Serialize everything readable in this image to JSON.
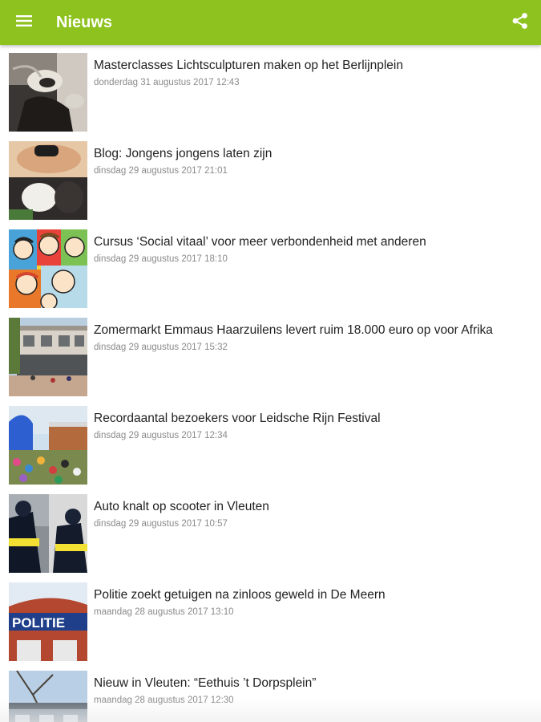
{
  "appbar": {
    "title": "Nieuws",
    "menu_icon": "hamburger-menu-icon",
    "share_icon": "share-icon",
    "color": "#8dc21f"
  },
  "news": [
    {
      "title": "Masterclasses Lichtsculpturen maken op het Berlijnplein",
      "date": "donderdag 31 augustus 2017 12:43"
    },
    {
      "title": "Blog: Jongens jongens laten zijn",
      "date": "dinsdag 29 augustus 2017 21:01"
    },
    {
      "title": "Cursus ‘Social vitaal’ voor meer verbondenheid met anderen",
      "date": "dinsdag 29 augustus 2017 18:10"
    },
    {
      "title": "Zomermarkt Emmaus Haarzuilens levert ruim 18.000 euro op voor Afrika",
      "date": "dinsdag 29 augustus 2017 15:32"
    },
    {
      "title": "Recordaantal bezoekers voor Leidsche Rijn Festival",
      "date": "dinsdag 29 augustus 2017 12:34"
    },
    {
      "title": "Auto knalt op scooter in Vleuten",
      "date": "dinsdag 29 augustus 2017 10:57"
    },
    {
      "title": "Politie zoekt getuigen na zinloos geweld in De Meern",
      "date": "maandag 28 augustus 2017 13:10"
    },
    {
      "title": "Nieuw in Vleuten: “Eethuis ’t Dorpsplein”",
      "date": "maandag 28 augustus 2017 12:30"
    }
  ],
  "thumb_sign_text": "POLITIE"
}
